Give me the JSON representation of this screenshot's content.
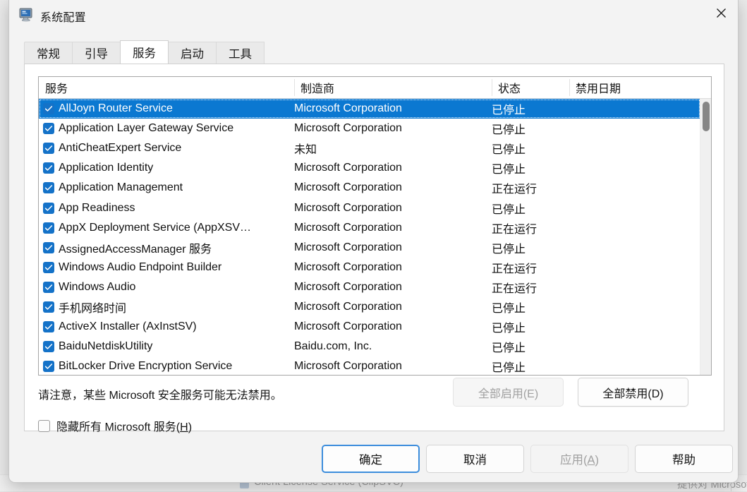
{
  "backdrop": {
    "row_service": "Client License Service (ClipSVC)",
    "row_desc": "提供对 Microsoft Store ..."
  },
  "window": {
    "title": "系统配置",
    "icon": "system-configuration-icon",
    "close_icon": "close-icon"
  },
  "tabs": [
    {
      "label": "常规",
      "selected": false
    },
    {
      "label": "引导",
      "selected": false
    },
    {
      "label": "服务",
      "selected": true
    },
    {
      "label": "启动",
      "selected": false
    },
    {
      "label": "工具",
      "selected": false
    }
  ],
  "services_tab": {
    "columns": [
      "服务",
      "制造商",
      "状态",
      "禁用日期"
    ],
    "rows": [
      {
        "checked": true,
        "name": "AllJoyn Router Service",
        "manufacturer": "Microsoft Corporation",
        "status": "已停止",
        "disabled_date": "",
        "selected": true
      },
      {
        "checked": true,
        "name": "Application Layer Gateway Service",
        "manufacturer": "Microsoft Corporation",
        "status": "已停止",
        "disabled_date": "",
        "selected": false
      },
      {
        "checked": true,
        "name": "AntiCheatExpert Service",
        "manufacturer": "未知",
        "status": "已停止",
        "disabled_date": "",
        "selected": false
      },
      {
        "checked": true,
        "name": "Application Identity",
        "manufacturer": "Microsoft Corporation",
        "status": "已停止",
        "disabled_date": "",
        "selected": false
      },
      {
        "checked": true,
        "name": "Application Management",
        "manufacturer": "Microsoft Corporation",
        "status": "正在运行",
        "disabled_date": "",
        "selected": false
      },
      {
        "checked": true,
        "name": "App Readiness",
        "manufacturer": "Microsoft Corporation",
        "status": "已停止",
        "disabled_date": "",
        "selected": false
      },
      {
        "checked": true,
        "name": "AppX Deployment Service (AppXSV…",
        "manufacturer": "Microsoft Corporation",
        "status": "正在运行",
        "disabled_date": "",
        "selected": false
      },
      {
        "checked": true,
        "name": "AssignedAccessManager 服务",
        "manufacturer": "Microsoft Corporation",
        "status": "已停止",
        "disabled_date": "",
        "selected": false
      },
      {
        "checked": true,
        "name": "Windows Audio Endpoint Builder",
        "manufacturer": "Microsoft Corporation",
        "status": "正在运行",
        "disabled_date": "",
        "selected": false
      },
      {
        "checked": true,
        "name": "Windows Audio",
        "manufacturer": "Microsoft Corporation",
        "status": "正在运行",
        "disabled_date": "",
        "selected": false
      },
      {
        "checked": true,
        "name": "手机网络时间",
        "manufacturer": "Microsoft Corporation",
        "status": "已停止",
        "disabled_date": "",
        "selected": false
      },
      {
        "checked": true,
        "name": "ActiveX Installer (AxInstSV)",
        "manufacturer": "Microsoft Corporation",
        "status": "已停止",
        "disabled_date": "",
        "selected": false
      },
      {
        "checked": true,
        "name": "BaiduNetdiskUtility",
        "manufacturer": "Baidu.com, Inc.",
        "status": "已停止",
        "disabled_date": "",
        "selected": false
      },
      {
        "checked": true,
        "name": "BitLocker Drive Encryption Service",
        "manufacturer": "Microsoft Corporation",
        "status": "已停止",
        "disabled_date": "",
        "selected": false
      }
    ],
    "note": "请注意，某些 Microsoft 安全服务可能无法禁用。",
    "enable_all_label": "全部启用(E)",
    "enable_all_enabled": false,
    "disable_all_label": "全部禁用(D)",
    "disable_all_enabled": true,
    "hide_ms_label_pre": "隐藏所有 Microsoft 服务(",
    "hide_ms_label_key": "H",
    "hide_ms_label_post": ")",
    "hide_ms_checked": false
  },
  "footer": {
    "ok_label": "确定",
    "cancel_label": "取消",
    "apply_label_pre": "应用(",
    "apply_label_key": "A",
    "apply_label_post": ")",
    "apply_enabled": false,
    "help_label": "帮助"
  },
  "colors": {
    "selection_blue": "#0b78d1",
    "checkbox_blue": "#1472c8",
    "focus_border": "#3c8ddc",
    "window_bg": "#f3f3f3"
  }
}
